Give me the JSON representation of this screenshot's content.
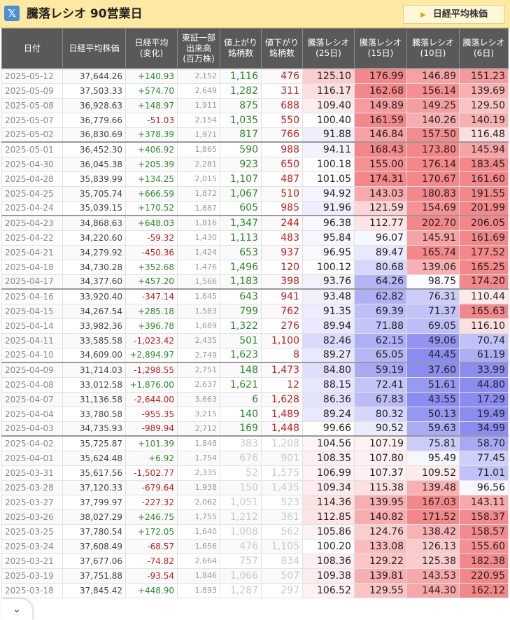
{
  "header": {
    "x_icon": "x-logo-icon",
    "title": "騰落レシオ 90営業日",
    "toggle_label": "日経平均株価",
    "toggle_icon": "triangle-right-icon"
  },
  "table": {
    "columns": [
      "日付",
      "日経平均株価",
      "日経平均\n(変化)",
      "東証一部\n出来高\n(百万株)",
      "値上がり\n銘柄数",
      "値下がり\n銘柄数",
      "騰落レシオ\n(25日)",
      "騰落レシオ\n(15日)",
      "騰落レシオ\n(10日)",
      "騰落レシオ\n(6日)"
    ],
    "rows": [
      {
        "date": "2025-05-12",
        "close": "37,644.26",
        "change": "+140.93",
        "vol": "2,152",
        "adv": "1,116",
        "dec": "476",
        "r25": "125.10",
        "r15": "176.99",
        "r10": "146.89",
        "r6": "151.23"
      },
      {
        "date": "2025-05-09",
        "close": "37,503.33",
        "change": "+574.70",
        "vol": "2,649",
        "adv": "1,282",
        "dec": "311",
        "r25": "116.17",
        "r15": "162.68",
        "r10": "156.14",
        "r6": "139.69"
      },
      {
        "date": "2025-05-08",
        "close": "36,928.63",
        "change": "+148.97",
        "vol": "1,911",
        "adv": "875",
        "dec": "688",
        "r25": "109.40",
        "r15": "149.89",
        "r10": "149.25",
        "r6": "129.50"
      },
      {
        "date": "2025-05-07",
        "close": "36,779.66",
        "change": "-51.03",
        "vol": "2,154",
        "adv": "1,035",
        "dec": "550",
        "r25": "100.40",
        "r15": "161.59",
        "r10": "140.26",
        "r6": "140.19"
      },
      {
        "date": "2025-05-02",
        "close": "36,830.69",
        "change": "+378.39",
        "vol": "1,971",
        "adv": "817",
        "dec": "766",
        "r25": "91.88",
        "r15": "146.84",
        "r10": "157.50",
        "r6": "116.48"
      },
      {
        "date": "2025-05-01",
        "close": "36,452.30",
        "change": "+406.92",
        "vol": "1,865",
        "adv": "590",
        "dec": "988",
        "r25": "94.11",
        "r15": "168.43",
        "r10": "173.80",
        "r6": "145.94"
      },
      {
        "date": "2025-04-30",
        "close": "36,045.38",
        "change": "+205.39",
        "vol": "2,281",
        "adv": "923",
        "dec": "650",
        "r25": "100.18",
        "r15": "155.00",
        "r10": "176.14",
        "r6": "183.45"
      },
      {
        "date": "2025-04-28",
        "close": "35,839.99",
        "change": "+134.25",
        "vol": "2,015",
        "adv": "1,107",
        "dec": "487",
        "r25": "101.05",
        "r15": "174.31",
        "r10": "170.67",
        "r6": "161.60"
      },
      {
        "date": "2025-04-25",
        "close": "35,705.74",
        "change": "+666.59",
        "vol": "1,872",
        "adv": "1,067",
        "dec": "510",
        "r25": "94.92",
        "r15": "143.03",
        "r10": "180.83",
        "r6": "191.55"
      },
      {
        "date": "2025-04-24",
        "close": "35,039.15",
        "change": "+170.52",
        "vol": "1,887",
        "adv": "605",
        "dec": "985",
        "r25": "91.96",
        "r15": "121.59",
        "r10": "154.69",
        "r6": "201.99"
      },
      {
        "date": "2025-04-23",
        "close": "34,868.63",
        "change": "+648.03",
        "vol": "1,816",
        "adv": "1,347",
        "dec": "244",
        "r25": "96.38",
        "r15": "112.77",
        "r10": "202.70",
        "r6": "206.05"
      },
      {
        "date": "2025-04-22",
        "close": "34,220.60",
        "change": "-59.32",
        "vol": "1,430",
        "adv": "1,113",
        "dec": "483",
        "r25": "95.84",
        "r15": "96.07",
        "r10": "145.91",
        "r6": "161.69"
      },
      {
        "date": "2025-04-21",
        "close": "34,279.92",
        "change": "-450.36",
        "vol": "1,424",
        "adv": "653",
        "dec": "937",
        "r25": "96.95",
        "r15": "89.47",
        "r10": "165.74",
        "r6": "177.52"
      },
      {
        "date": "2025-04-18",
        "close": "34,730.28",
        "change": "+352.68",
        "vol": "1,476",
        "adv": "1,496",
        "dec": "120",
        "r25": "100.12",
        "r15": "80.68",
        "r10": "139.06",
        "r6": "165.25"
      },
      {
        "date": "2025-04-17",
        "close": "34,377.60",
        "change": "+457.20",
        "vol": "1,566",
        "adv": "1,183",
        "dec": "398",
        "r25": "93.76",
        "r15": "64.26",
        "r10": "98.75",
        "r6": "174.20"
      },
      {
        "date": "2025-04-16",
        "close": "33,920.40",
        "change": "-347.14",
        "vol": "1,645",
        "adv": "643",
        "dec": "941",
        "r25": "93.48",
        "r15": "62.82",
        "r10": "76.31",
        "r6": "110.44"
      },
      {
        "date": "2025-04-15",
        "close": "34,267.54",
        "change": "+285.18",
        "vol": "1,583",
        "adv": "799",
        "dec": "762",
        "r25": "91.35",
        "r15": "69.39",
        "r10": "71.37",
        "r6": "165.63"
      },
      {
        "date": "2025-04-14",
        "close": "33,982.36",
        "change": "+396.78",
        "vol": "1,689",
        "adv": "1,322",
        "dec": "276",
        "r25": "89.94",
        "r15": "71.88",
        "r10": "69.05",
        "r6": "116.10"
      },
      {
        "date": "2025-04-11",
        "close": "33,585.58",
        "change": "-1,023.42",
        "vol": "2,435",
        "adv": "501",
        "dec": "1,100",
        "r25": "82.46",
        "r15": "62.15",
        "r10": "49.06",
        "r6": "70.74"
      },
      {
        "date": "2025-04-10",
        "close": "34,609.00",
        "change": "+2,894.97",
        "vol": "2,749",
        "adv": "1,623",
        "dec": "8",
        "r25": "89.27",
        "r15": "65.05",
        "r10": "44.45",
        "r6": "61.19"
      },
      {
        "date": "2025-04-09",
        "close": "31,714.03",
        "change": "-1,298.55",
        "vol": "2,751",
        "adv": "148",
        "dec": "1,473",
        "r25": "84.80",
        "r15": "59.19",
        "r10": "37.60",
        "r6": "33.99"
      },
      {
        "date": "2025-04-08",
        "close": "33,012.58",
        "change": "+1,876.00",
        "vol": "2,637",
        "adv": "1,621",
        "dec": "12",
        "r25": "88.15",
        "r15": "72.41",
        "r10": "51.61",
        "r6": "44.80"
      },
      {
        "date": "2025-04-07",
        "close": "31,136.58",
        "change": "-2,644.00",
        "vol": "3,663",
        "adv": "6",
        "dec": "1,628",
        "r25": "86.36",
        "r15": "67.83",
        "r10": "43.55",
        "r6": "17.29"
      },
      {
        "date": "2025-04-04",
        "close": "33,780.58",
        "change": "-955.35",
        "vol": "3,215",
        "adv": "140",
        "dec": "1,489",
        "r25": "89.24",
        "r15": "80.32",
        "r10": "50.13",
        "r6": "19.49"
      },
      {
        "date": "2025-04-03",
        "close": "34,735.93",
        "change": "-989.94",
        "vol": "2,712",
        "adv": "169",
        "dec": "1,448",
        "r25": "99.66",
        "r15": "90.52",
        "r10": "59.63",
        "r6": "34.99"
      },
      {
        "date": "2025-04-02",
        "close": "35,725.87",
        "change": "+101.39",
        "vol": "1,848",
        "adv": "383",
        "dec": "1,208",
        "r25": "104.56",
        "r15": "107.19",
        "r10": "75.81",
        "r6": "58.70"
      },
      {
        "date": "2025-04-01",
        "close": "35,624.48",
        "change": "+6.92",
        "vol": "1,754",
        "adv": "676",
        "dec": "901",
        "r25": "108.35",
        "r15": "107.80",
        "r10": "95.49",
        "r6": "77.45"
      },
      {
        "date": "2025-03-31",
        "close": "35,617.56",
        "change": "-1,502.77",
        "vol": "2,335",
        "adv": "52",
        "dec": "1,575",
        "r25": "106.99",
        "r15": "107.37",
        "r10": "109.52",
        "r6": "71.01"
      },
      {
        "date": "2025-03-28",
        "close": "37,120.33",
        "change": "-679.64",
        "vol": "1,938",
        "adv": "150",
        "dec": "1,435",
        "r25": "109.34",
        "r15": "115.38",
        "r10": "139.48",
        "r6": "96.56"
      },
      {
        "date": "2025-03-27",
        "close": "37,799.97",
        "change": "-227.32",
        "vol": "2,062",
        "adv": "1,051",
        "dec": "523",
        "r25": "114.36",
        "r15": "139.95",
        "r10": "167.03",
        "r6": "143.11"
      },
      {
        "date": "2025-03-26",
        "close": "38,027.29",
        "change": "+246.75",
        "vol": "1,755",
        "adv": "1,212",
        "dec": "361",
        "r25": "112.85",
        "r15": "140.82",
        "r10": "171.52",
        "r6": "158.37"
      },
      {
        "date": "2025-03-25",
        "close": "37,780.54",
        "change": "+172.05",
        "vol": "1,640",
        "adv": "1,008",
        "dec": "562",
        "r25": "105.86",
        "r15": "124.76",
        "r10": "138.42",
        "r6": "158.57"
      },
      {
        "date": "2025-03-24",
        "close": "37,608.49",
        "change": "-68.57",
        "vol": "1,656",
        "adv": "476",
        "dec": "1,105",
        "r25": "100.20",
        "r15": "133.08",
        "r10": "126.13",
        "r6": "155.60"
      },
      {
        "date": "2025-03-21",
        "close": "37,677.06",
        "change": "-74.82",
        "vol": "2,664",
        "adv": "757",
        "dec": "834",
        "r25": "108.36",
        "r15": "129.22",
        "r10": "125.38",
        "r6": "182.38"
      },
      {
        "date": "2025-03-19",
        "close": "37,751.88",
        "change": "-93.54",
        "vol": "1,846",
        "adv": "1,066",
        "dec": "507",
        "r25": "109.38",
        "r15": "139.81",
        "r10": "143.53",
        "r6": "220.95"
      },
      {
        "date": "2025-03-18",
        "close": "37,845.42",
        "change": "+448.90",
        "vol": "1,893",
        "adv": "1,287",
        "dec": "297",
        "r25": "106.52",
        "r15": "129.55",
        "r10": "144.30",
        "r6": "162.12"
      }
    ],
    "week_start_rows": [
      0,
      5,
      10,
      15,
      20,
      25
    ],
    "dimmed_from_row": 25
  },
  "scroll_button": {
    "icon": "chevron-down-icon",
    "glyph": "⌄"
  },
  "colors": {
    "header_bg": "#fde9a2",
    "table_header_bg": "#595959",
    "up": "#2a8a2a",
    "down": "#c02020",
    "hot": "#f4878a",
    "cold": "#8a8cf0"
  }
}
